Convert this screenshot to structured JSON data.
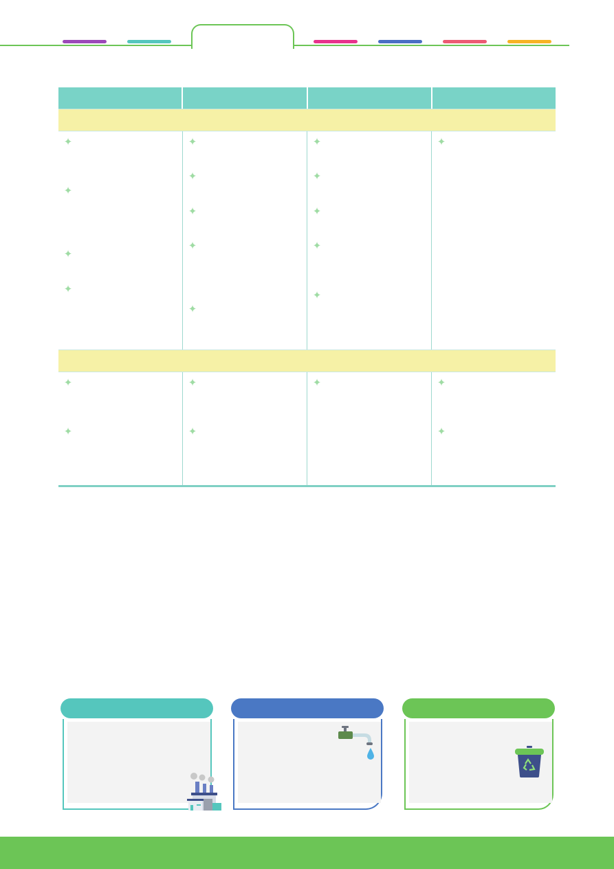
{
  "page": {
    "header": {
      "tab_colors": [
        "#9b49b8",
        "#55c6bd",
        "#e8328c",
        "#4a6fc4",
        "#ec5b73",
        "#f7b324"
      ],
      "active_tab_color": "#6cc556"
    },
    "table": {
      "header_color": "#79d3c7",
      "band_color": "#f6f1a6",
      "bullet_icon": "sparkle-icon",
      "bullet_color": "#9fdca4",
      "section_1": {
        "bullets_per_column": [
          4,
          5,
          5,
          1
        ]
      },
      "section_2": {
        "bullets_per_column": [
          2,
          2,
          1,
          2
        ]
      }
    },
    "cards": [
      {
        "header_color": "#55c6bd",
        "border_color": "#55c6bd",
        "icon": "factory-icon"
      },
      {
        "header_color": "#4a78c4",
        "border_color": "#4a78c4",
        "icon": "water-tap-icon"
      },
      {
        "header_color": "#6cc556",
        "border_color": "#6cc556",
        "icon": "recycle-bin-icon"
      }
    ],
    "footer_color": "#6cc556"
  }
}
